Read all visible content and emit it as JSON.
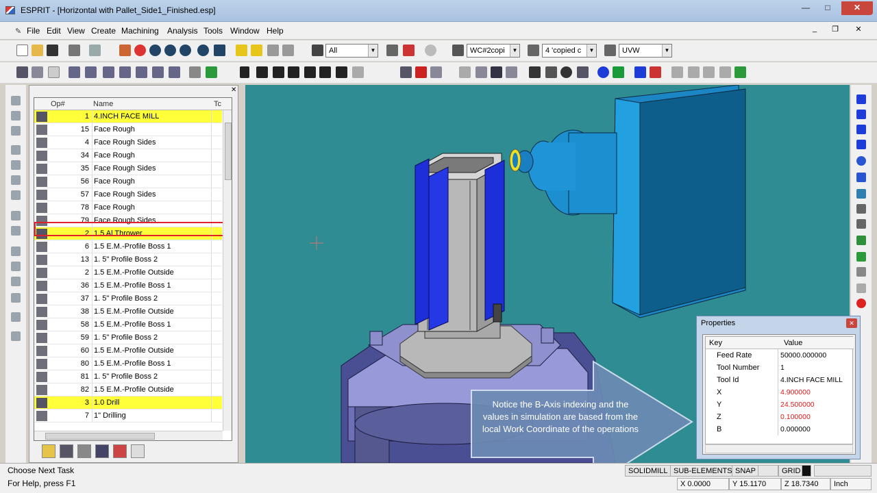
{
  "window": {
    "title": "ESPRIT - [Horizontal with Pallet_Side1_Finished.esp]",
    "minimize": "—",
    "maximize": "□",
    "close": "✕"
  },
  "menu": {
    "items": [
      "File",
      "Edit",
      "View",
      "Create",
      "Machining",
      "Analysis",
      "Tools",
      "Window",
      "Help"
    ],
    "mdi_minimize": "_",
    "mdi_restore": "❐",
    "mdi_close": "✕"
  },
  "toolbar": {
    "filter_combo": "All",
    "workcoord_combo": "WC#2copi",
    "layer_combo": "4 'copied c",
    "plane_combo": "UVW"
  },
  "operations": {
    "header_op": "Op#",
    "header_name": "Name",
    "header_tool": "Tc",
    "close_glyph": "✕",
    "rows": [
      {
        "op": "1",
        "name": "4.INCH FACE MILL",
        "tool": true
      },
      {
        "op": "15",
        "name": "Face Rough",
        "tool": false
      },
      {
        "op": "4",
        "name": "Face Rough Sides",
        "tool": false
      },
      {
        "op": "34",
        "name": "Face Rough",
        "tool": false
      },
      {
        "op": "35",
        "name": "Face Rough Sides",
        "tool": false
      },
      {
        "op": "56",
        "name": "Face Rough",
        "tool": false
      },
      {
        "op": "57",
        "name": "Face Rough Sides",
        "tool": false
      },
      {
        "op": "78",
        "name": "Face Rough",
        "tool": false
      },
      {
        "op": "79",
        "name": "Face Rough Sides",
        "tool": false
      },
      {
        "op": "2",
        "name": "1.5 Al Thrower",
        "tool": true
      },
      {
        "op": "6",
        "name": "1.5 E.M.-Profile Boss 1",
        "tool": false
      },
      {
        "op": "13",
        "name": "1. 5\" Profile Boss 2",
        "tool": false
      },
      {
        "op": "2",
        "name": "1.5 E.M.-Profile Outside",
        "tool": false
      },
      {
        "op": "36",
        "name": "1.5 E.M.-Profile Boss 1",
        "tool": false
      },
      {
        "op": "37",
        "name": "1. 5\" Profile Boss 2",
        "tool": false
      },
      {
        "op": "38",
        "name": "1.5 E.M.-Profile Outside",
        "tool": false
      },
      {
        "op": "58",
        "name": "1.5 E.M.-Profile Boss 1",
        "tool": false
      },
      {
        "op": "59",
        "name": "1. 5\" Profile Boss 2",
        "tool": false
      },
      {
        "op": "60",
        "name": "1.5 E.M.-Profile Outside",
        "tool": false
      },
      {
        "op": "80",
        "name": "1.5 E.M.-Profile Boss 1",
        "tool": false
      },
      {
        "op": "81",
        "name": "1. 5\" Profile Boss 2",
        "tool": false
      },
      {
        "op": "82",
        "name": "1.5 E.M.-Profile Outside",
        "tool": false
      },
      {
        "op": "3",
        "name": "1.0 Drill",
        "tool": true
      },
      {
        "op": "7",
        "name": "1\" Drilling",
        "tool": false
      }
    ]
  },
  "callout": {
    "text": "Notice the B-Axis indexing and the values in simulation are based from the local Work Coordinate of the operations"
  },
  "properties": {
    "title": "Properties",
    "close_glyph": "✕",
    "header_key": "Key",
    "header_value": "Value",
    "rows": [
      {
        "key": "Feed Rate",
        "value": "50000.000000",
        "highlight": false
      },
      {
        "key": "Tool Number",
        "value": "1",
        "highlight": false
      },
      {
        "key": "Tool Id",
        "value": "4.INCH FACE MILL",
        "highlight": false
      },
      {
        "key": "X",
        "value": "4.900000",
        "highlight": true
      },
      {
        "key": "Y",
        "value": "24.500000",
        "highlight": true
      },
      {
        "key": "Z",
        "value": "0.100000",
        "highlight": true
      },
      {
        "key": "B",
        "value": "0.000000",
        "highlight": false
      }
    ]
  },
  "status": {
    "task": "Choose Next Task",
    "help": "For Help, press F1",
    "panels": [
      "SOLIDMILL",
      "SUB-ELEMENTS",
      "SNAP",
      "GRID"
    ],
    "x": "X 0.0000",
    "y": "Y 15.1170",
    "z": "Z 18.7340",
    "units": "Inch"
  },
  "colors": {
    "viewport_bg": "#2f8c92",
    "tool_row_highlight": "#ffff3a",
    "selection_outline": "#e0202a",
    "changed_value": "#e01a1a",
    "spindle_blue": "#1c8fd0",
    "fixture_blue": "#1d2fd8"
  }
}
